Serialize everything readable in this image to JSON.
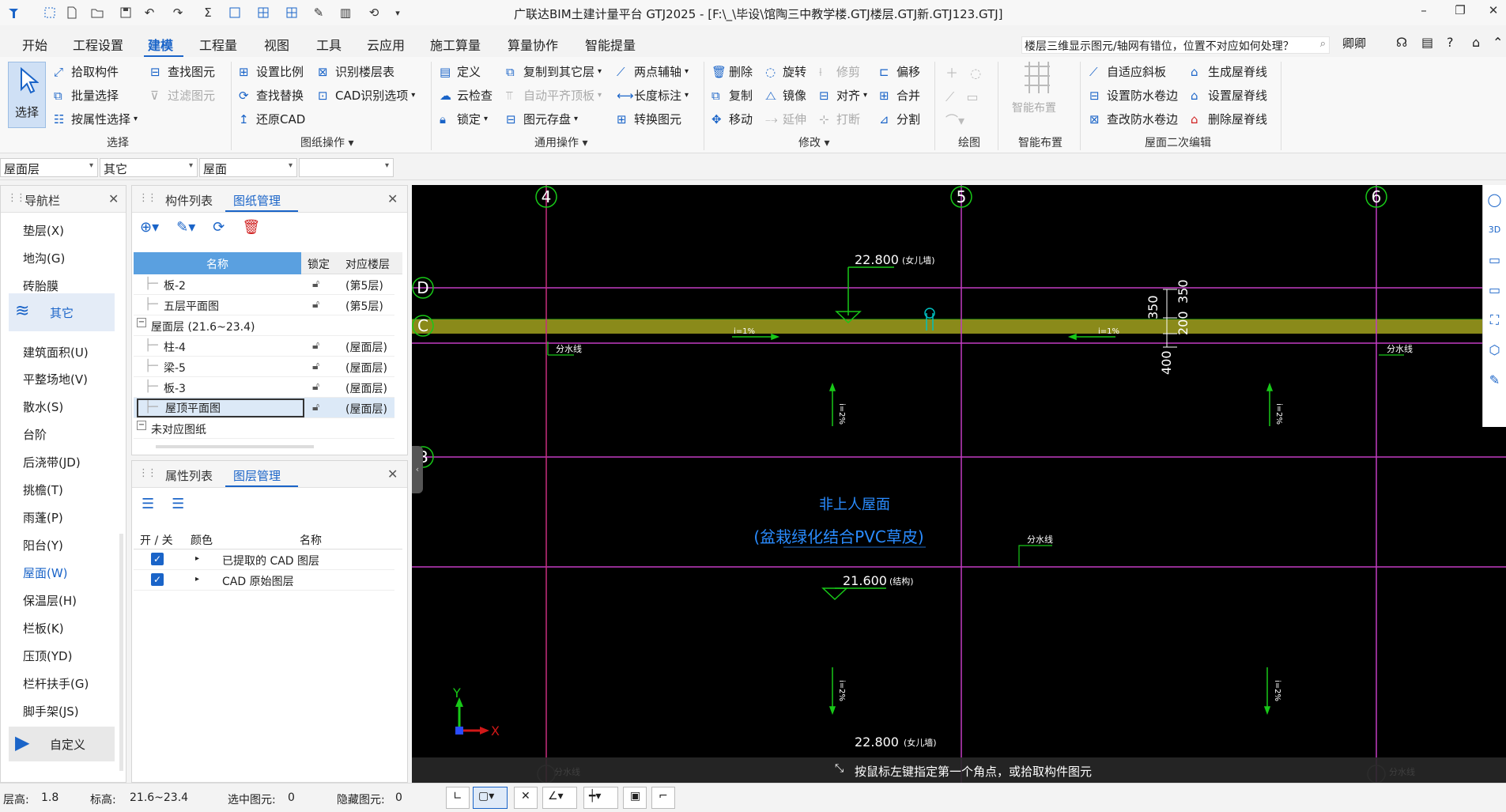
{
  "window": {
    "title": "广联达BIM土建计量平台 GTJ2025 - [F:\\_\\毕设\\馆陶三中教学楼.GTJ楼层.GTJ新.GTJ123.GTJ]"
  },
  "menu": {
    "items": [
      "开始",
      "工程设置",
      "建模",
      "工程量",
      "视图",
      "工具",
      "云应用",
      "施工算量",
      "算量协作",
      "智能提量"
    ],
    "active": "建模",
    "help_search": "楼层三维显示图元/轴网有错位，位置不对应如何处理？",
    "user": "卿卿"
  },
  "ribbon": {
    "select": {
      "big": "选择",
      "items": [
        "拾取构件",
        "批量选择",
        "按属性选择"
      ],
      "find": [
        "查找图元",
        "过滤图元"
      ],
      "group": "选择"
    },
    "drawing_ops": {
      "items": [
        "设置比例",
        "查找替换",
        "还原CAD",
        "识别楼层表",
        "CAD识别选项"
      ],
      "group": "图纸操作"
    },
    "common_ops": {
      "items": [
        "定义",
        "云检查",
        "锁定",
        "复制到其它层",
        "自动平齐顶板",
        "图元存盘",
        "两点辅轴",
        "长度标注",
        "转换图元"
      ],
      "group": "通用操作"
    },
    "modify": {
      "items": [
        "删除",
        "复制",
        "移动",
        "旋转",
        "镜像",
        "延伸",
        "修剪",
        "对齐",
        "打断",
        "偏移",
        "合并",
        "分割"
      ],
      "group": "修改"
    },
    "draw": {
      "group": "绘图"
    },
    "smart": {
      "big": "智能布置",
      "group": "智能布置"
    },
    "roof": {
      "items": [
        "自适应斜板",
        "设置防水卷边",
        "查改防水卷边",
        "生成屋脊线",
        "设置屋脊线",
        "删除屋脊线"
      ],
      "group": "屋面二次编辑"
    }
  },
  "floorbar": {
    "floor": "屋面层",
    "type": "其它",
    "component": "屋面",
    "extra": ""
  },
  "nav": {
    "title": "导航栏",
    "items": [
      "垫层(X)",
      "地沟(G)",
      "砖胎膜",
      "其它",
      "建筑面积(U)",
      "平整场地(V)",
      "散水(S)",
      "台阶",
      "后浇带(JD)",
      "挑檐(T)",
      "雨蓬(P)",
      "阳台(Y)",
      "屋面(W)",
      "保温层(H)",
      "栏板(K)",
      "压顶(YD)",
      "栏杆扶手(G)",
      "脚手架(JS)",
      "自定义"
    ],
    "selected": "屋面(W)"
  },
  "drawings": {
    "tabs": [
      "构件列表",
      "图纸管理"
    ],
    "active": "图纸管理",
    "headers": [
      "名称",
      "锁定",
      "对应楼层"
    ],
    "rows": [
      {
        "name": "板-2",
        "floor": "(第5层)"
      },
      {
        "name": "五层平面图",
        "floor": "(第5层)"
      },
      {
        "name": "屋面层 (21.6~23.4)",
        "floor": "",
        "group": true
      },
      {
        "name": "柱-4",
        "floor": "(屋面层)"
      },
      {
        "name": "梁-5",
        "floor": "(屋面层)"
      },
      {
        "name": "板-3",
        "floor": "(屋面层)"
      },
      {
        "name": "屋顶平面图",
        "floor": "(屋面层)",
        "selected": true
      },
      {
        "name": "未对应图纸",
        "floor": "",
        "group": true
      }
    ]
  },
  "layers": {
    "tabs": [
      "属性列表",
      "图层管理"
    ],
    "active": "图层管理",
    "headers": [
      "开 / 关",
      "颜色",
      "名称"
    ],
    "rows": [
      {
        "name": "已提取的 CAD 图层",
        "on": true
      },
      {
        "name": "CAD 原始图层",
        "on": true
      }
    ]
  },
  "canvas": {
    "axes_v": [
      "4",
      "5",
      "6"
    ],
    "axes_h": [
      "D",
      "C",
      "B"
    ],
    "elev_top": "22.800",
    "elev_top_note": "(女儿墙)",
    "elev_mid": "21.600",
    "elev_mid_note": "(结构)",
    "elev_bottom": "22.800",
    "elev_bottom_note": "(女儿墙)",
    "dims": [
      "350",
      "200",
      "350",
      "400"
    ],
    "slope": "i=1%",
    "slope_v": "i=2%",
    "split_line": "分水线",
    "roof_title": "非上人屋面",
    "roof_sub": "(盆栽绿化结合PVC草皮)",
    "axis_x": "X",
    "axis_y": "Y",
    "prompt": "按鼠标左键指定第一个角点，或拾取构件图元"
  },
  "status": {
    "floor_height_label": "层高:",
    "floor_height": "1.8",
    "elev_label": "标高:",
    "elev": "21.6~23.4",
    "selected_label": "选中图元:",
    "selected": "0",
    "hidden_label": "隐藏图元:",
    "hidden": "0"
  },
  "colors": {
    "accent": "#1a64c8",
    "grid_pink": "#c23cc2",
    "grid_red": "#d01818",
    "green": "#18c818",
    "beam": "#8a8a1a",
    "cyan": "#00c0c0"
  }
}
